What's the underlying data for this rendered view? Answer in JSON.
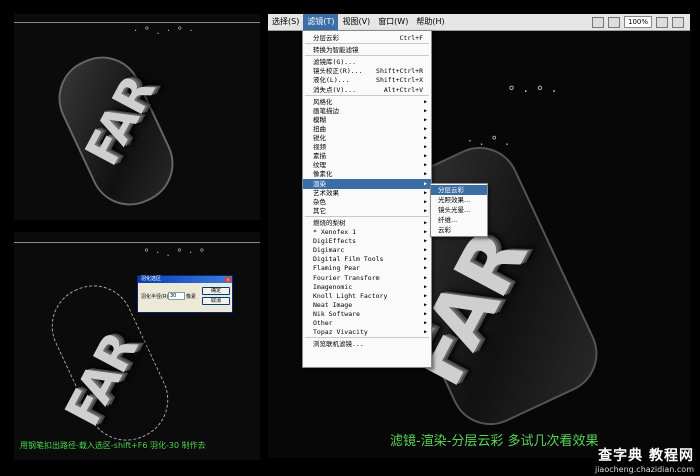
{
  "menubar": {
    "items": [
      {
        "label": "选择(S)"
      },
      {
        "label": "滤镜(T)"
      },
      {
        "label": "视图(V)"
      },
      {
        "label": "窗口(W)"
      },
      {
        "label": "帮助(H)"
      }
    ],
    "zoom": "100%"
  },
  "filter_menu": {
    "rows": [
      {
        "label": "分层云彩",
        "shortcut": "Ctrl+F"
      },
      {
        "label": "转换为智能滤镜",
        "shortcut": ""
      },
      {
        "label": "滤镜库(G)...",
        "shortcut": ""
      },
      {
        "label": "镜头校正(R)...",
        "shortcut": "Shift+Ctrl+R"
      },
      {
        "label": "液化(L)...",
        "shortcut": "Shift+Ctrl+X"
      },
      {
        "label": "消失点(V)...",
        "shortcut": "Alt+Ctrl+V"
      },
      {
        "label": "风格化",
        "sub": true
      },
      {
        "label": "画笔描边",
        "sub": true
      },
      {
        "label": "模糊",
        "sub": true
      },
      {
        "label": "扭曲",
        "sub": true
      },
      {
        "label": "锐化",
        "sub": true
      },
      {
        "label": "视频",
        "sub": true
      },
      {
        "label": "素描",
        "sub": true
      },
      {
        "label": "纹理",
        "sub": true
      },
      {
        "label": "像素化",
        "sub": true
      },
      {
        "label": "渲染",
        "sub": true
      },
      {
        "label": "艺术效果",
        "sub": true
      },
      {
        "label": "杂色",
        "sub": true
      },
      {
        "label": "其它",
        "sub": true
      },
      {
        "label": "燃烧的梨树",
        "sub": true
      },
      {
        "label": "* Xenofex 1",
        "sub": true
      },
      {
        "label": "DigiEffects",
        "sub": true
      },
      {
        "label": "Digimarc",
        "sub": true
      },
      {
        "label": "Digital Film Tools",
        "sub": true
      },
      {
        "label": "Flaming Pear",
        "sub": true
      },
      {
        "label": "Fourier Transform",
        "sub": true
      },
      {
        "label": "Imagenomic",
        "sub": true
      },
      {
        "label": "Knoll Light Factory",
        "sub": true
      },
      {
        "label": "Neat Image",
        "sub": true
      },
      {
        "label": "Nik Software",
        "sub": true
      },
      {
        "label": "Other",
        "sub": true
      },
      {
        "label": "Topaz Vivacity",
        "sub": true
      },
      {
        "label": "浏览联机滤镜...",
        "sub": false
      }
    ]
  },
  "render_submenu": {
    "items": [
      "分层云彩",
      "光照效果...",
      "镜头光晕...",
      "纤维...",
      "云彩"
    ]
  },
  "feather_dialog": {
    "title": "羽化选区",
    "radius_label": "羽化半径(R):",
    "radius_value": "30",
    "unit": "像素",
    "ok": "确定",
    "cancel": "取消"
  },
  "artwork": {
    "word": "FAR"
  },
  "captions": {
    "left": "用钢笔扣出路径-载入选区-shift+F6 羽化-30 制作去",
    "main": "滤镜-渲染-分层云彩 多试几次看效果"
  },
  "watermark": {
    "top": "查字典 教程网",
    "bottom": "jiaocheng.chazidian.com"
  },
  "colors": {
    "menu_highlight": "#3a6ea5",
    "caption_left": "#4cd64c",
    "caption_main": "#57d657"
  }
}
